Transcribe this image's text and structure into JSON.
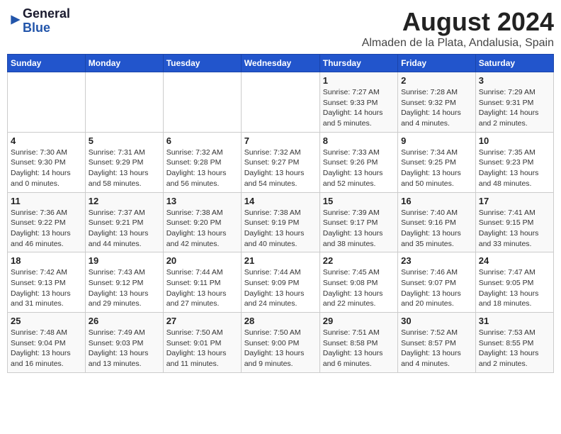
{
  "header": {
    "logo_general": "General",
    "logo_blue": "Blue",
    "title": "August 2024",
    "subtitle": "Almaden de la Plata, Andalusia, Spain"
  },
  "calendar": {
    "headers": [
      "Sunday",
      "Monday",
      "Tuesday",
      "Wednesday",
      "Thursday",
      "Friday",
      "Saturday"
    ],
    "weeks": [
      [
        {
          "num": "",
          "detail": ""
        },
        {
          "num": "",
          "detail": ""
        },
        {
          "num": "",
          "detail": ""
        },
        {
          "num": "",
          "detail": ""
        },
        {
          "num": "1",
          "detail": "Sunrise: 7:27 AM\nSunset: 9:33 PM\nDaylight: 14 hours\nand 5 minutes."
        },
        {
          "num": "2",
          "detail": "Sunrise: 7:28 AM\nSunset: 9:32 PM\nDaylight: 14 hours\nand 4 minutes."
        },
        {
          "num": "3",
          "detail": "Sunrise: 7:29 AM\nSunset: 9:31 PM\nDaylight: 14 hours\nand 2 minutes."
        }
      ],
      [
        {
          "num": "4",
          "detail": "Sunrise: 7:30 AM\nSunset: 9:30 PM\nDaylight: 14 hours\nand 0 minutes."
        },
        {
          "num": "5",
          "detail": "Sunrise: 7:31 AM\nSunset: 9:29 PM\nDaylight: 13 hours\nand 58 minutes."
        },
        {
          "num": "6",
          "detail": "Sunrise: 7:32 AM\nSunset: 9:28 PM\nDaylight: 13 hours\nand 56 minutes."
        },
        {
          "num": "7",
          "detail": "Sunrise: 7:32 AM\nSunset: 9:27 PM\nDaylight: 13 hours\nand 54 minutes."
        },
        {
          "num": "8",
          "detail": "Sunrise: 7:33 AM\nSunset: 9:26 PM\nDaylight: 13 hours\nand 52 minutes."
        },
        {
          "num": "9",
          "detail": "Sunrise: 7:34 AM\nSunset: 9:25 PM\nDaylight: 13 hours\nand 50 minutes."
        },
        {
          "num": "10",
          "detail": "Sunrise: 7:35 AM\nSunset: 9:23 PM\nDaylight: 13 hours\nand 48 minutes."
        }
      ],
      [
        {
          "num": "11",
          "detail": "Sunrise: 7:36 AM\nSunset: 9:22 PM\nDaylight: 13 hours\nand 46 minutes."
        },
        {
          "num": "12",
          "detail": "Sunrise: 7:37 AM\nSunset: 9:21 PM\nDaylight: 13 hours\nand 44 minutes."
        },
        {
          "num": "13",
          "detail": "Sunrise: 7:38 AM\nSunset: 9:20 PM\nDaylight: 13 hours\nand 42 minutes."
        },
        {
          "num": "14",
          "detail": "Sunrise: 7:38 AM\nSunset: 9:19 PM\nDaylight: 13 hours\nand 40 minutes."
        },
        {
          "num": "15",
          "detail": "Sunrise: 7:39 AM\nSunset: 9:17 PM\nDaylight: 13 hours\nand 38 minutes."
        },
        {
          "num": "16",
          "detail": "Sunrise: 7:40 AM\nSunset: 9:16 PM\nDaylight: 13 hours\nand 35 minutes."
        },
        {
          "num": "17",
          "detail": "Sunrise: 7:41 AM\nSunset: 9:15 PM\nDaylight: 13 hours\nand 33 minutes."
        }
      ],
      [
        {
          "num": "18",
          "detail": "Sunrise: 7:42 AM\nSunset: 9:13 PM\nDaylight: 13 hours\nand 31 minutes."
        },
        {
          "num": "19",
          "detail": "Sunrise: 7:43 AM\nSunset: 9:12 PM\nDaylight: 13 hours\nand 29 minutes."
        },
        {
          "num": "20",
          "detail": "Sunrise: 7:44 AM\nSunset: 9:11 PM\nDaylight: 13 hours\nand 27 minutes."
        },
        {
          "num": "21",
          "detail": "Sunrise: 7:44 AM\nSunset: 9:09 PM\nDaylight: 13 hours\nand 24 minutes."
        },
        {
          "num": "22",
          "detail": "Sunrise: 7:45 AM\nSunset: 9:08 PM\nDaylight: 13 hours\nand 22 minutes."
        },
        {
          "num": "23",
          "detail": "Sunrise: 7:46 AM\nSunset: 9:07 PM\nDaylight: 13 hours\nand 20 minutes."
        },
        {
          "num": "24",
          "detail": "Sunrise: 7:47 AM\nSunset: 9:05 PM\nDaylight: 13 hours\nand 18 minutes."
        }
      ],
      [
        {
          "num": "25",
          "detail": "Sunrise: 7:48 AM\nSunset: 9:04 PM\nDaylight: 13 hours\nand 16 minutes."
        },
        {
          "num": "26",
          "detail": "Sunrise: 7:49 AM\nSunset: 9:03 PM\nDaylight: 13 hours\nand 13 minutes."
        },
        {
          "num": "27",
          "detail": "Sunrise: 7:50 AM\nSunset: 9:01 PM\nDaylight: 13 hours\nand 11 minutes."
        },
        {
          "num": "28",
          "detail": "Sunrise: 7:50 AM\nSunset: 9:00 PM\nDaylight: 13 hours\nand 9 minutes."
        },
        {
          "num": "29",
          "detail": "Sunrise: 7:51 AM\nSunset: 8:58 PM\nDaylight: 13 hours\nand 6 minutes."
        },
        {
          "num": "30",
          "detail": "Sunrise: 7:52 AM\nSunset: 8:57 PM\nDaylight: 13 hours\nand 4 minutes."
        },
        {
          "num": "31",
          "detail": "Sunrise: 7:53 AM\nSunset: 8:55 PM\nDaylight: 13 hours\nand 2 minutes."
        }
      ]
    ]
  }
}
